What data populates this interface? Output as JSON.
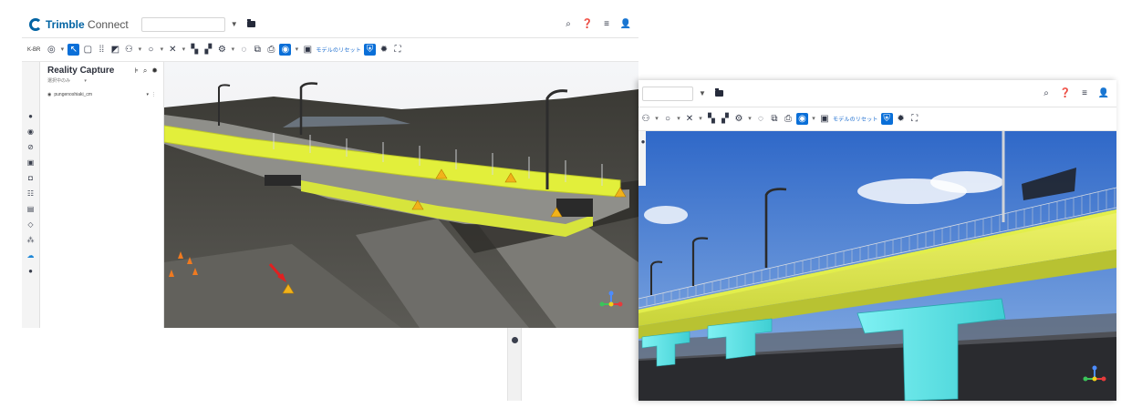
{
  "app": {
    "logo_text": "Trimble",
    "logo_suffix": "Connect"
  },
  "toolbar_left": {
    "back_label": "K-BR"
  },
  "toolbar": {
    "model_reset_label": "モデルのリセット"
  },
  "panel": {
    "title": "Reality Capture",
    "subtitle": "選択中のみ",
    "layer_name": "pungenoshiaki_cm"
  },
  "icons": {
    "search": "search-icon",
    "help": "help-icon",
    "menu": "menu-icon",
    "user": "user-icon",
    "folder": "folder-icon",
    "warning": "warning-icon",
    "navigation_cube": "navigation-gizmo-icon"
  },
  "colors": {
    "accent": "#0a6fd8",
    "bridge_highlight": "#e2ef3b",
    "pier_highlight": "#4fe6e8",
    "warning": "#f1b21a",
    "arrow": "#e02020"
  }
}
